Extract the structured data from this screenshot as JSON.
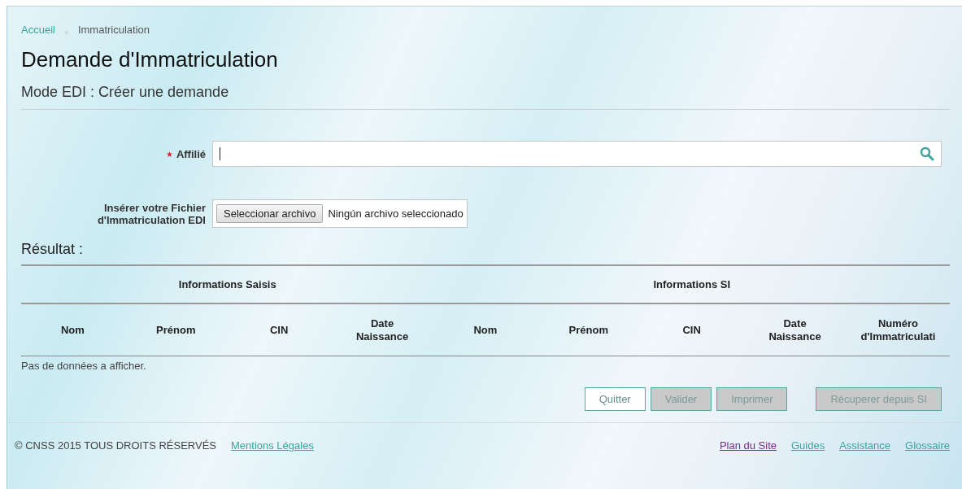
{
  "breadcrumb": [
    {
      "label": "Accueil",
      "link": true
    },
    {
      "label": "Immatriculation",
      "link": false
    }
  ],
  "title": "Demande d'Immatriculation",
  "subtitle": "Mode EDI : Créer une demande",
  "form": {
    "affilie": {
      "label": "Affilié",
      "required": true
    },
    "file": {
      "label": "Insérer votre Fichier d'Immatriculation EDI",
      "button": "Seleccionar archivo",
      "status": "Ningún archivo seleccionado"
    }
  },
  "result": {
    "title": "Résultat :",
    "groups": [
      {
        "label": "Informations Saisis",
        "columns": [
          "Nom",
          "Prénom",
          "CIN",
          "Date Naissance"
        ]
      },
      {
        "label": "Informations SI",
        "columns": [
          "Nom",
          "Prénom",
          "CIN",
          "Date Naissance",
          "Numéro d'Immatriculati"
        ]
      }
    ],
    "empty": "Pas de données a afficher."
  },
  "buttons": [
    {
      "label": "Quitter",
      "disabled": false
    },
    {
      "label": "Valider",
      "disabled": true
    },
    {
      "label": "Imprimer",
      "disabled": true
    },
    {
      "label": "Récuperer depuis SI",
      "disabled": true
    }
  ],
  "footer": {
    "copyright": "© CNSS 2015 TOUS DROITS RÉSERVÉS",
    "left_links": [
      {
        "label": "Mentions Légales",
        "visited": false
      }
    ],
    "right_links": [
      {
        "label": "Plan du Site",
        "visited": true
      },
      {
        "label": "Guides",
        "visited": false
      },
      {
        "label": "Assistance",
        "visited": false
      },
      {
        "label": "Glossaire",
        "visited": false
      }
    ]
  }
}
